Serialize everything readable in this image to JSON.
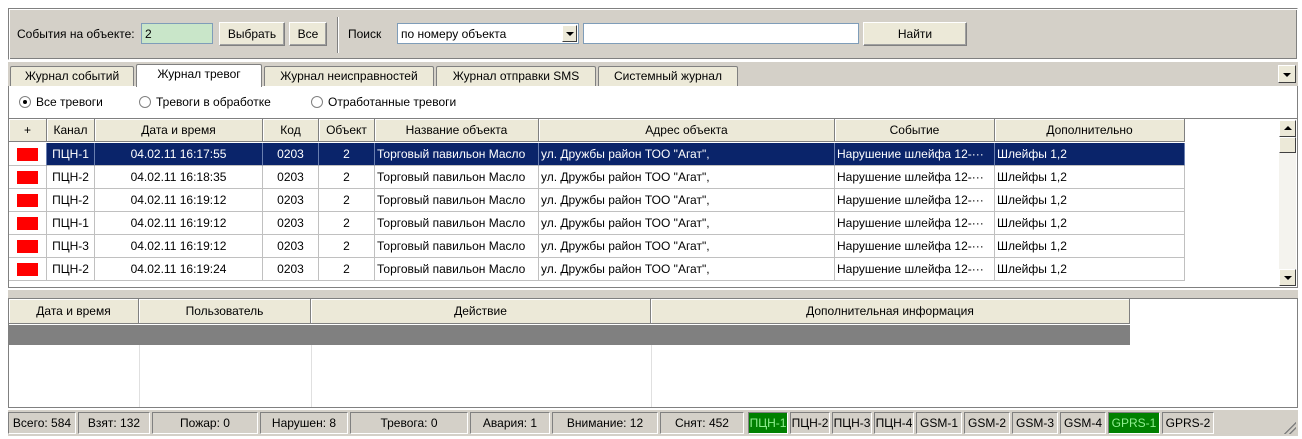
{
  "toolbar": {
    "events_label": "События на объекте:",
    "events_value": "2",
    "select_button": "Выбрать",
    "all_button": "Все",
    "search_label": "Поиск",
    "search_mode": "по номеру объекта",
    "search_value": "",
    "find_button": "Найти"
  },
  "tabs": [
    {
      "label": "Журнал событий"
    },
    {
      "label": "Журнал тревог"
    },
    {
      "label": "Журнал неисправностей"
    },
    {
      "label": "Журнал отправки SMS"
    },
    {
      "label": "Системный журнал"
    }
  ],
  "radios": [
    {
      "label": "Все тревоги",
      "checked": true
    },
    {
      "label": "Тревоги в обработке",
      "checked": false
    },
    {
      "label": "Отработанные тревоги",
      "checked": false
    }
  ],
  "table": {
    "columns": [
      "+",
      "Канал",
      "Дата и время",
      "Код",
      "Объект",
      "Название объекта",
      "Адрес объекта",
      "Событие",
      "Дополнительно"
    ],
    "rows": [
      {
        "channel": "ПЦН-1",
        "datetime": "04.02.11  16:17:55",
        "code": "0203",
        "object": "2",
        "name": "Торговый павильон Масло",
        "address": "ул. Дружбы  район  ТОО \"Агат\",",
        "event": "Нарушение шлейфа 12-···",
        "extra": "Шлейфы 1,2"
      },
      {
        "channel": "ПЦН-2",
        "datetime": "04.02.11  16:18:35",
        "code": "0203",
        "object": "2",
        "name": "Торговый павильон Масло",
        "address": "ул. Дружбы  район  ТОО \"Агат\",",
        "event": "Нарушение шлейфа 12-···",
        "extra": "Шлейфы 1,2"
      },
      {
        "channel": "ПЦН-2",
        "datetime": "04.02.11  16:19:12",
        "code": "0203",
        "object": "2",
        "name": "Торговый павильон Масло",
        "address": "ул. Дружбы  район  ТОО \"Агат\",",
        "event": "Нарушение шлейфа 12-···",
        "extra": "Шлейфы 1,2"
      },
      {
        "channel": "ПЦН-1",
        "datetime": "04.02.11  16:19:12",
        "code": "0203",
        "object": "2",
        "name": "Торговый павильон Масло",
        "address": "ул. Дружбы  район  ТОО \"Агат\",",
        "event": "Нарушение шлейфа 12-···",
        "extra": "Шлейфы 1,2"
      },
      {
        "channel": "ПЦН-3",
        "datetime": "04.02.11  16:19:12",
        "code": "0203",
        "object": "2",
        "name": "Торговый павильон Масло",
        "address": "ул. Дружбы  район  ТОО \"Агат\",",
        "event": "Нарушение шлейфа 12-···",
        "extra": "Шлейфы 1,2"
      },
      {
        "channel": "ПЦН-2",
        "datetime": "04.02.11  16:19:24",
        "code": "0203",
        "object": "2",
        "name": "Торговый павильон Масло",
        "address": "ул. Дружбы  район  ТОО \"Агат\",",
        "event": "Нарушение шлейфа 12-···",
        "extra": "Шлейфы 1,2"
      }
    ]
  },
  "lower_table": {
    "columns": [
      "Дата и время",
      "Пользователь",
      "Действие",
      "Дополнительная информация"
    ]
  },
  "status": {
    "total": "Всего: 584",
    "taken": "Взят: 132",
    "fire": "Пожар: 0",
    "violated": "Нарушен: 8",
    "alarm": "Тревога: 0",
    "accident": "Авария: 1",
    "attention": "Внимание: 12",
    "removed": "Снят: 452",
    "channels": [
      {
        "label": "ПЦН-1",
        "active": true
      },
      {
        "label": "ПЦН-2",
        "active": false
      },
      {
        "label": "ПЦН-3",
        "active": false
      },
      {
        "label": "ПЦН-4",
        "active": false
      },
      {
        "label": "GSM-1",
        "active": false
      },
      {
        "label": "GSM-2",
        "active": false
      },
      {
        "label": "GSM-3",
        "active": false
      },
      {
        "label": "GSM-4",
        "active": false
      },
      {
        "label": "GPRS-1",
        "active": true
      },
      {
        "label": "GPRS-2",
        "active": false
      }
    ]
  },
  "colors": {
    "alarm_flag": "#ff0000",
    "selection": "#0a246a",
    "channel_active": "#008000"
  }
}
